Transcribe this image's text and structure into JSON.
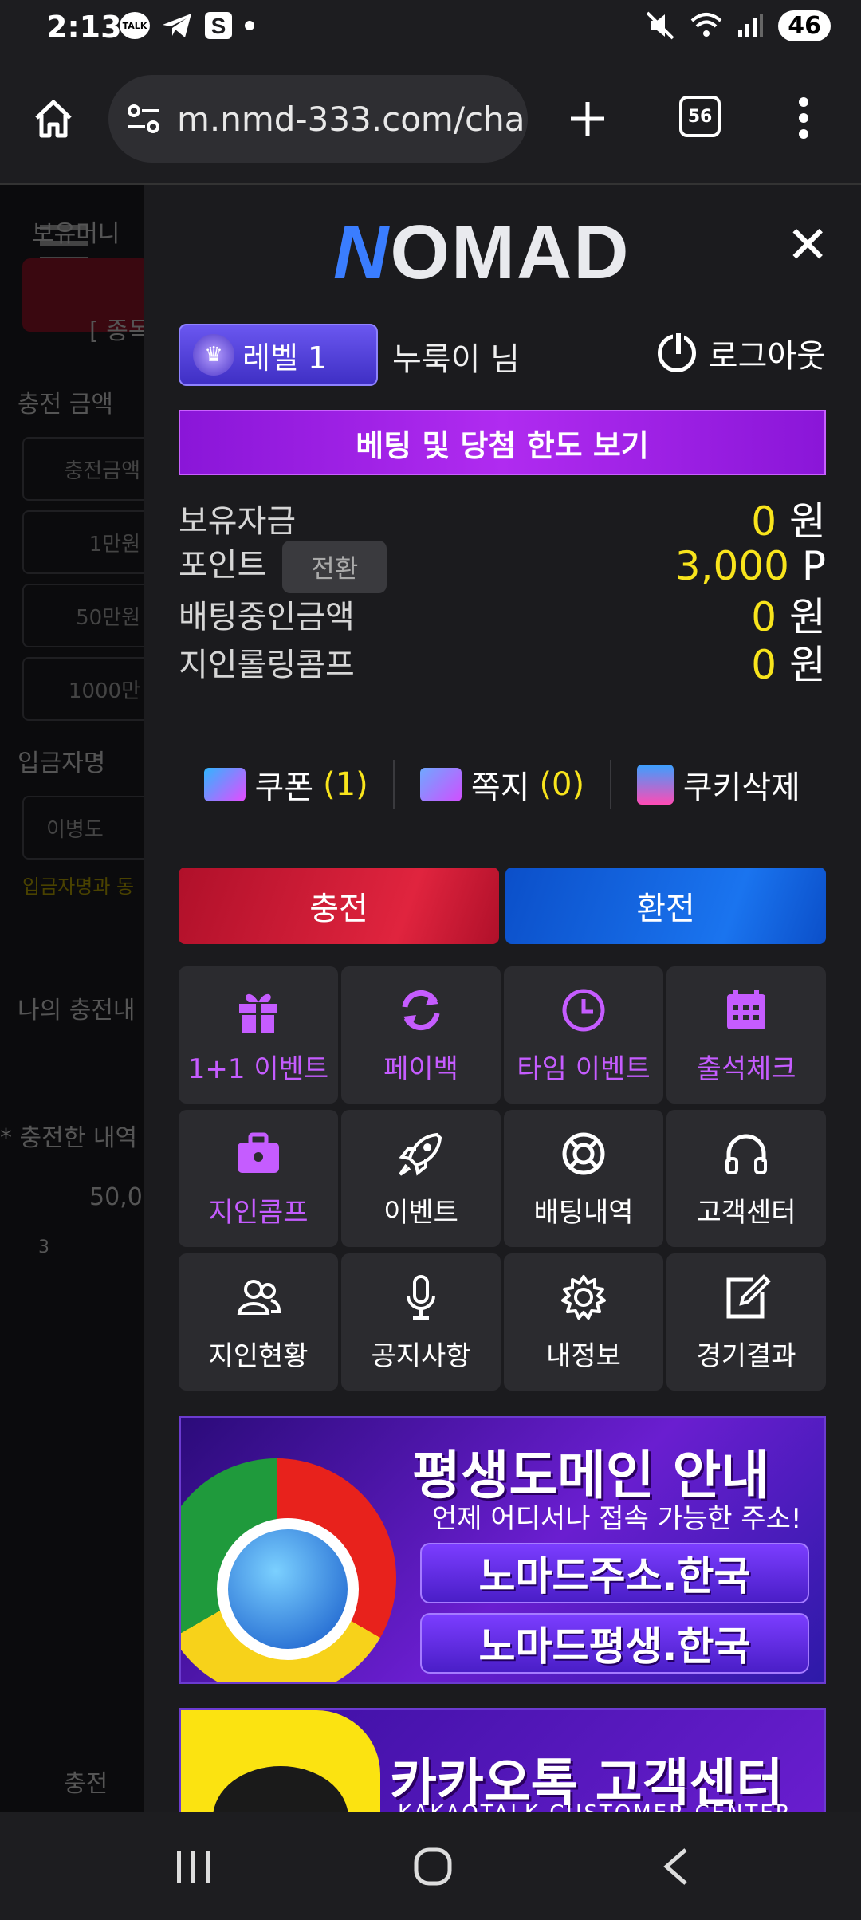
{
  "status_bar": {
    "time": "2:13",
    "talk_badge": "TALK",
    "battery": "46"
  },
  "browser": {
    "url": "m.nmd-333.com/cha",
    "tab_count": "56"
  },
  "background_page": {
    "labels": [
      "보유머니",
      "[ 종목",
      "충전 금액",
      "충전금액",
      "1만원",
      "50만원",
      "1000만",
      "입금자명",
      "이병도",
      "입금자명과 동",
      "나의 충전내",
      "* 충전한 내역",
      "50,0",
      "3",
      "충전"
    ]
  },
  "drawer": {
    "logo": "OMAD",
    "logo_letter": "N",
    "level": "레벨 1",
    "username": "누룩이 님",
    "logout": "로그아웃",
    "limit_button": "베팅 및 당첨 한도 보기",
    "balance": {
      "label": "보유자금",
      "value": "0",
      "unit": "원"
    },
    "points": {
      "label": "포인트",
      "switch_button": "전환",
      "value": "3,000",
      "unit": "P"
    },
    "betting": {
      "label": "배팅중인금액",
      "value": "0",
      "unit": "원"
    },
    "referral": {
      "label": "지인롤링콤프",
      "value": "0",
      "unit": "원"
    },
    "quick": {
      "coupon": {
        "label": "쿠폰",
        "count": "(1)"
      },
      "message": {
        "label": "쪽지",
        "count": "(0)"
      },
      "cookie": {
        "label": "쿠키삭제"
      }
    },
    "deposit": "충전",
    "withdraw": "환전",
    "menu": [
      {
        "label": "1+1 이벤트",
        "icon": "gift-icon"
      },
      {
        "label": "페이백",
        "icon": "refresh-icon"
      },
      {
        "label": "타임 이벤트",
        "icon": "clock-icon"
      },
      {
        "label": "출석체크",
        "icon": "calendar-icon"
      },
      {
        "label": "지인콤프",
        "icon": "briefcase-icon"
      },
      {
        "label": "이벤트",
        "icon": "rocket-icon"
      },
      {
        "label": "배팅내역",
        "icon": "lifebuoy-icon"
      },
      {
        "label": "고객센터",
        "icon": "headphones-icon"
      },
      {
        "label": "지인현황",
        "icon": "users-icon"
      },
      {
        "label": "공지사항",
        "icon": "microphone-icon"
      },
      {
        "label": "내정보",
        "icon": "gear-icon"
      },
      {
        "label": "경기결과",
        "icon": "edit-icon"
      }
    ],
    "banner1": {
      "title": "평생도메인 안내",
      "subtitle": "언제 어디서나 접속 가능한 주소!",
      "domain1": "노마드주소.한국",
      "domain2": "노마드평생.한국"
    },
    "banner2": {
      "title": "카카오톡 고객센터",
      "subtitle": "KAKAOTALK CUSTOMER CENTER"
    }
  },
  "colors": {
    "accent_yellow": "#f8e41c",
    "purple": "#c55cff",
    "deposit_red": "#e0243e",
    "withdraw_blue": "#1a74ef"
  }
}
